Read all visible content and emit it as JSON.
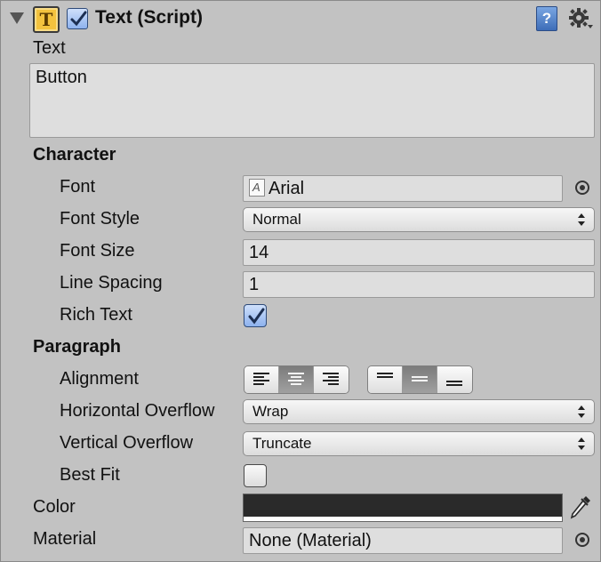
{
  "component": {
    "title": "Text (Script)",
    "enabled": true,
    "help_glyph": "?"
  },
  "text_section": {
    "label": "Text",
    "value": "Button"
  },
  "character": {
    "heading": "Character",
    "font": {
      "label": "Font",
      "value": "Arial"
    },
    "font_style": {
      "label": "Font Style",
      "value": "Normal"
    },
    "font_size": {
      "label": "Font Size",
      "value": "14"
    },
    "line_spacing": {
      "label": "Line Spacing",
      "value": "1"
    },
    "rich_text": {
      "label": "Rich Text",
      "checked": true
    }
  },
  "paragraph": {
    "heading": "Paragraph",
    "alignment": {
      "label": "Alignment",
      "horizontal": [
        "left",
        "center",
        "right"
      ],
      "horizontal_selected": "center",
      "vertical": [
        "top",
        "middle",
        "bottom"
      ],
      "vertical_selected": "middle"
    },
    "horizontal_overflow": {
      "label": "Horizontal Overflow",
      "value": "Wrap"
    },
    "vertical_overflow": {
      "label": "Vertical Overflow",
      "value": "Truncate"
    },
    "best_fit": {
      "label": "Best Fit",
      "checked": false
    }
  },
  "color": {
    "label": "Color",
    "value": "#2a2a2a"
  },
  "material": {
    "label": "Material",
    "value": "None (Material)"
  },
  "icons": {
    "foldout": "foldout-triangle-icon",
    "component": "text-component-icon",
    "help": "help-book-icon",
    "settings": "gear-icon",
    "object_picker": "object-picker-icon",
    "eyedropper": "eyedropper-icon"
  }
}
